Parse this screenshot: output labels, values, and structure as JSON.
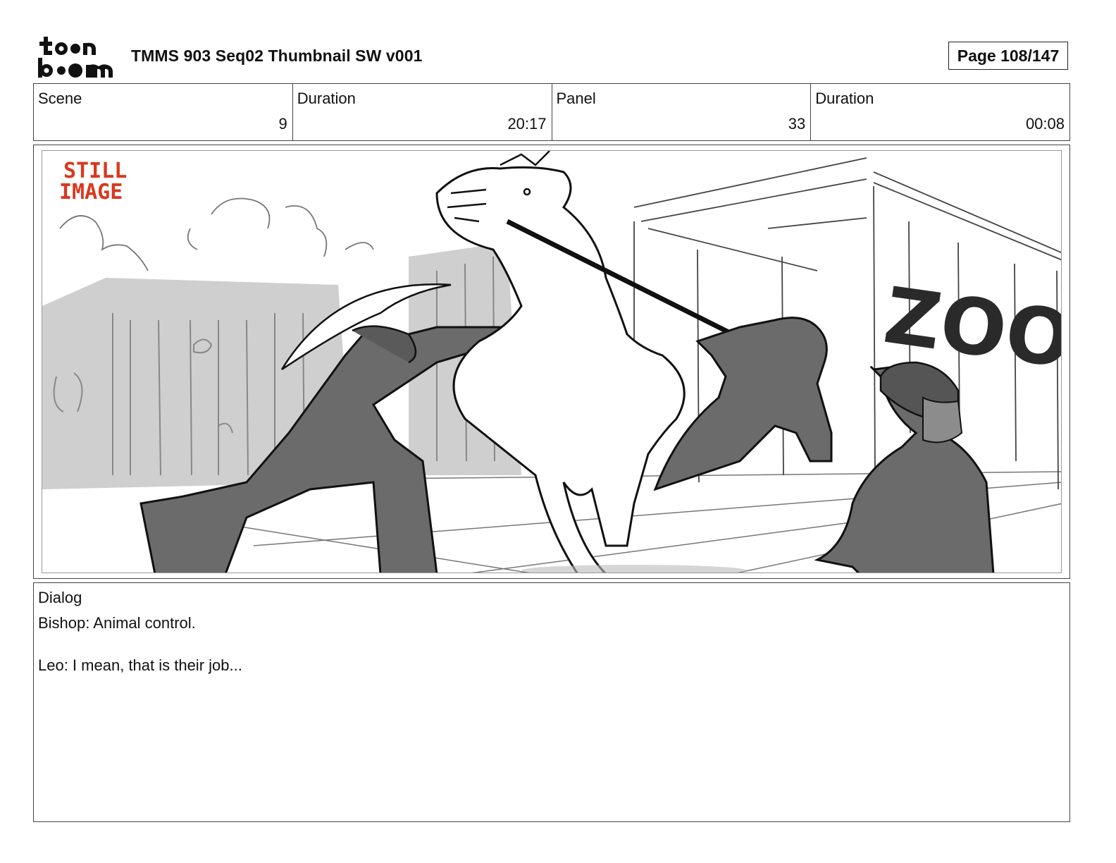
{
  "header": {
    "logo_text": "toonboom",
    "title": "TMMS 903 Seq02 Thumbnail SW v001",
    "page": "Page 108/147"
  },
  "info": {
    "scene_label": "Scene",
    "scene_value": "9",
    "scene_duration_label": "Duration",
    "scene_duration_value": "20:17",
    "panel_label": "Panel",
    "panel_value": "33",
    "panel_duration_label": "Duration",
    "panel_duration_value": "00:08"
  },
  "panel": {
    "stamp_line1": "STILL",
    "stamp_line2": "IMAGE",
    "sign_text": "ZOO",
    "stamp_color": "#d9381e"
  },
  "dialog": {
    "label": "Dialog",
    "lines": [
      "Bishop: Animal control.",
      "Leo: I mean, that is their job..."
    ]
  }
}
